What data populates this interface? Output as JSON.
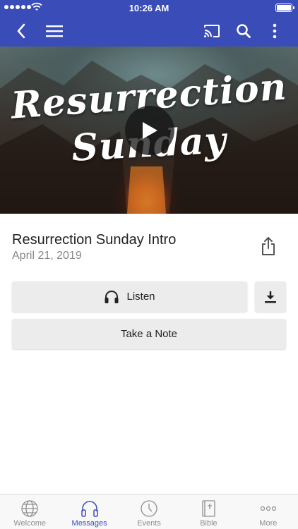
{
  "status_bar": {
    "time": "10:26 AM"
  },
  "hero": {
    "title_line1": "Resurrection",
    "title_line2": "Sunday"
  },
  "message": {
    "title": "Resurrection Sunday Intro",
    "date": "April 21, 2019"
  },
  "actions": {
    "listen_label": "Listen",
    "note_label": "Take a Note"
  },
  "tabs": [
    {
      "label": "Welcome",
      "icon": "globe-icon"
    },
    {
      "label": "Messages",
      "icon": "headphones-icon"
    },
    {
      "label": "Events",
      "icon": "clock-icon"
    },
    {
      "label": "Bible",
      "icon": "bible-icon"
    },
    {
      "label": "More",
      "icon": "more-dots-icon"
    }
  ],
  "colors": {
    "brand": "#3a4cb8",
    "background": "#ffffff",
    "button": "#ececed",
    "tab_inactive": "#8e8e93"
  }
}
